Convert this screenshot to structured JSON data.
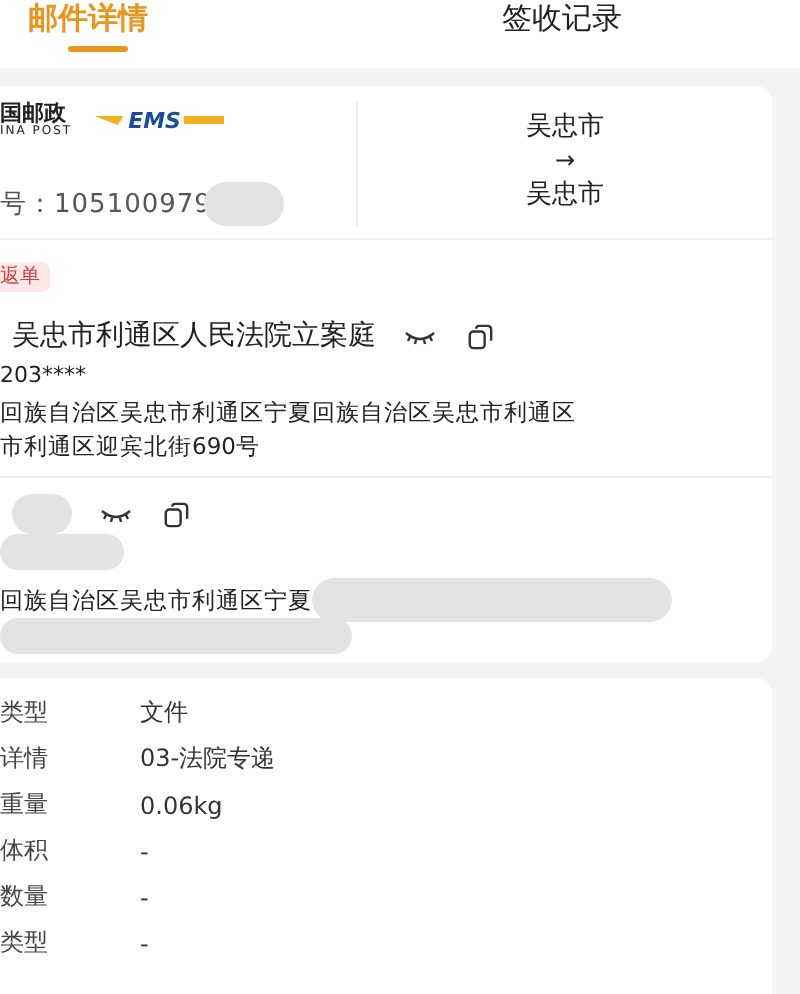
{
  "tabs": [
    {
      "label": "邮件详情",
      "selected": true
    },
    {
      "label": "签收记录",
      "selected": false
    }
  ],
  "waybill": {
    "brand_cn": "国邮政",
    "brand_en": "INA POST",
    "ems": "EMS",
    "number": "号：105100979",
    "from_city": "吴忠市",
    "arrow": "→",
    "to_city": "吴忠市",
    "tag": "返单"
  },
  "receiver": {
    "name": "吴忠市利通区人民法院立案庭",
    "phone": "203****",
    "address_lines": [
      "回族自治区吴忠市利通区宁夏回族自治区吴忠市利通区",
      "市利通区迎宾北街690号"
    ]
  },
  "sender": {
    "address": "回族自治区吴忠市利通区宁夏"
  },
  "details": [
    {
      "label": "类型",
      "value": "文件"
    },
    {
      "label": "详情",
      "value": "03-法院专递"
    },
    {
      "label": "重量",
      "value": "0.06kg"
    },
    {
      "label": "体积",
      "value": "-"
    },
    {
      "label": "数量",
      "value": "-"
    },
    {
      "label": "类型",
      "value": "-"
    }
  ]
}
